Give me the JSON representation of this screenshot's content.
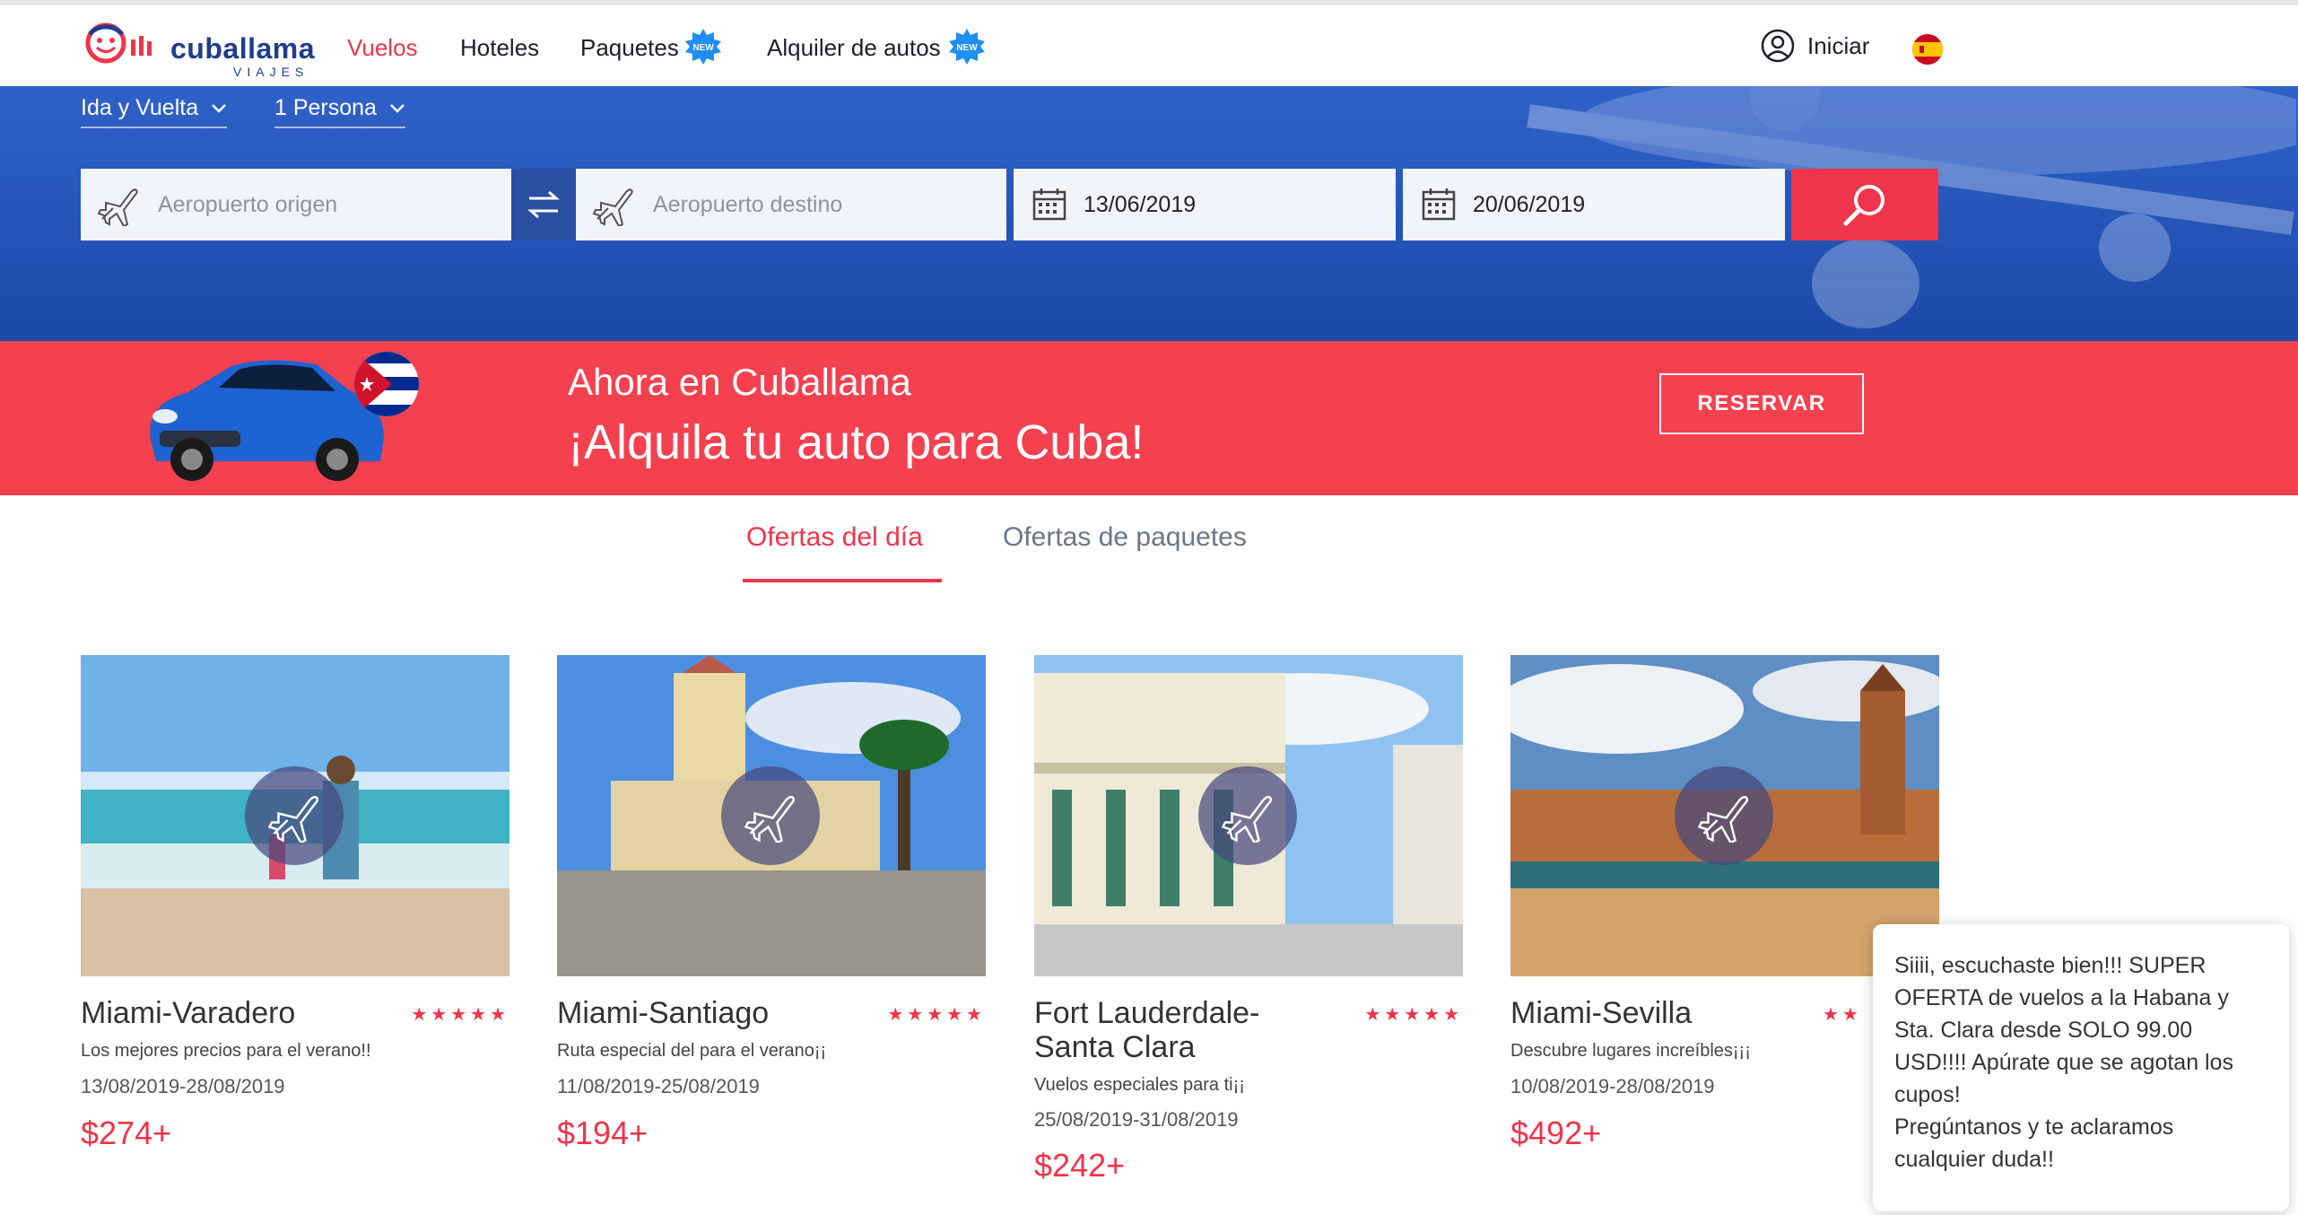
{
  "brand": {
    "name": "cuballama",
    "sub": "VIAJES"
  },
  "nav": {
    "items": [
      {
        "label": "Vuelos",
        "active": true
      },
      {
        "label": "Hoteles"
      },
      {
        "label": "Paquetes",
        "badge": "NEW"
      },
      {
        "label": "Alquiler de autos",
        "badge": "NEW"
      }
    ],
    "login_label": "Iniciar"
  },
  "search": {
    "trip_type": "Ida y Vuelta",
    "passengers": "1 Persona",
    "origin_placeholder": "Aeropuerto origen",
    "destination_placeholder": "Aeropuerto destino",
    "depart_date": "13/06/2019",
    "return_date": "20/06/2019"
  },
  "promo": {
    "line1": "Ahora en Cuballama",
    "line2": "¡Alquila tu auto para Cuba!",
    "button": "RESERVAR"
  },
  "tabs": [
    {
      "label": "Ofertas del día",
      "active": true
    },
    {
      "label": "Ofertas de paquetes"
    }
  ],
  "offers": [
    {
      "title": "Miami-Varadero",
      "desc": "Los mejores precios para el verano!!",
      "dates": "13/08/2019-28/08/2019",
      "price": "$274+",
      "stars": "★★★★★"
    },
    {
      "title": "Miami-Santiago",
      "desc": "Ruta especial del para el verano¡¡",
      "dates": "11/08/2019-25/08/2019",
      "price": "$194+",
      "stars": "★★★★★"
    },
    {
      "title": "Fort Lauderdale-Santa Clara",
      "desc": "Vuelos especiales para ti¡¡",
      "dates": "25/08/2019-31/08/2019",
      "price": "$242+",
      "stars": "★★★★★"
    },
    {
      "title": "Miami-Sevilla",
      "desc": "Descubre lugares increíbles¡¡¡",
      "dates": "10/08/2019-28/08/2019",
      "price": "$492+",
      "stars": "★★"
    }
  ],
  "chat": {
    "message": "Siiii, escuchaste bien!!! SUPER OFERTA de vuelos a la Habana y Sta. Clara desde SOLO 99.00 USD!!!! Apúrate que se agotan los cupos!",
    "message2": "Pregúntanos y te aclaramos cualquier duda!!"
  },
  "colors": {
    "accent": "#f0344b",
    "brand_blue": "#1f3d8a",
    "hero_blue": "#2453b6"
  }
}
